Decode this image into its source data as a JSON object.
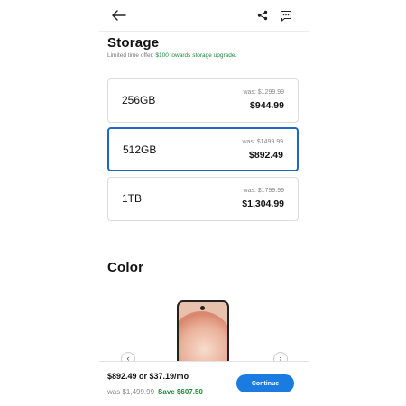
{
  "header": {
    "back_icon": "arrow-left-icon",
    "share_icon": "share-icon",
    "chat_icon": "chat-icon"
  },
  "storage": {
    "title": "Storage",
    "offer_prefix": "Limited time offer: ",
    "offer_highlight": "$100 towards storage upgrade.",
    "options": [
      {
        "label": "256GB",
        "was": "was: $1299.99",
        "price": "$944.99",
        "selected": false
      },
      {
        "label": "512GB",
        "was": "was: $1499.99",
        "price": "$892.49",
        "selected": true
      },
      {
        "label": "1TB",
        "was": "was: $1799.99",
        "price": "$1,304.99",
        "selected": false
      }
    ]
  },
  "color": {
    "title": "Color"
  },
  "footer": {
    "total": "$892.49 or $37.19/mo",
    "was": "was  $1,499.99",
    "save": "Save $607.50",
    "continue_label": "Continue"
  },
  "colors": {
    "accent": "#1a7be0",
    "selected_border": "#1e67c9",
    "offer_green": "#1a8a3a"
  }
}
